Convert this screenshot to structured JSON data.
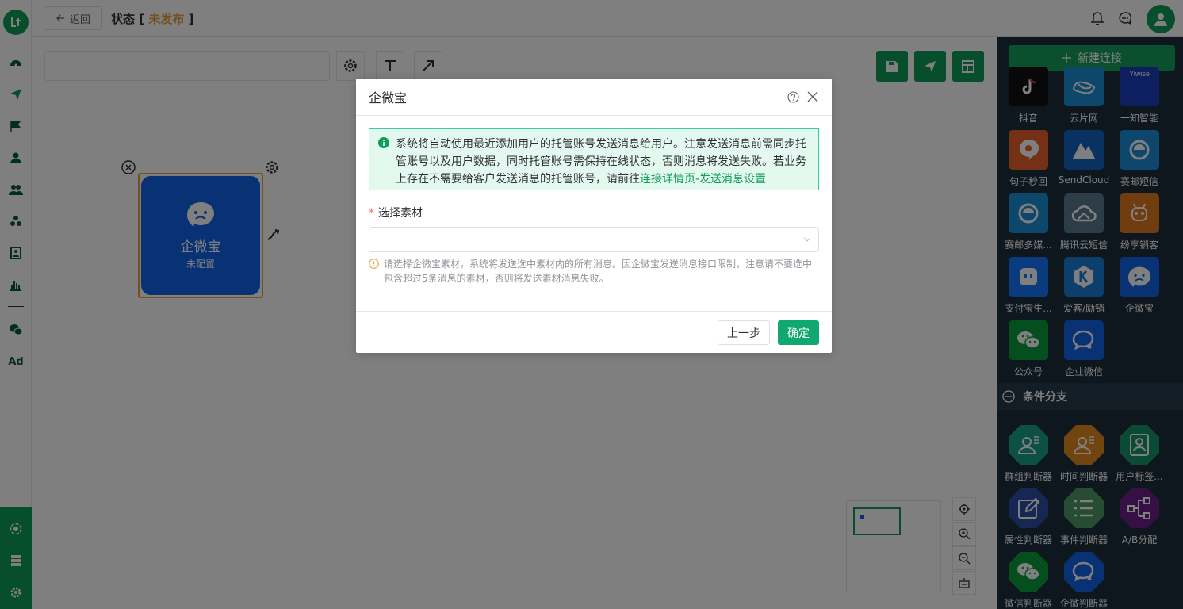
{
  "topbar": {
    "back_label": "返回",
    "status_label": "状态",
    "status_value": "未发布",
    "bracket_open": "[",
    "bracket_close": "]"
  },
  "canvas": {
    "node": {
      "name": "企微宝",
      "status": "未配置"
    }
  },
  "right_panel": {
    "new_connection_label": "新建连接",
    "connectors": [
      {
        "label": "抖音",
        "icon": "tiktok-icon",
        "color": "#111111"
      },
      {
        "label": "云片网",
        "icon": "yunpian-icon",
        "color": "#1a8fd8"
      },
      {
        "label": "一知智能",
        "icon": "yiwise-icon",
        "color": "#1a3fbf",
        "logo_text": "Yiwise"
      },
      {
        "label": "句子秒回",
        "icon": "chat-bubble-icon",
        "color": "#e8622c"
      },
      {
        "label": "SendCloud",
        "icon": "sendcloud-icon",
        "color": "#1565c0"
      },
      {
        "label": "赛邮短信",
        "icon": "submail-icon",
        "color": "#1a8fd8"
      },
      {
        "label": "赛邮多媒...",
        "icon": "submail-icon",
        "color": "#1a8fd8"
      },
      {
        "label": "腾讯云短信",
        "icon": "tencent-cloud-icon",
        "color": "#5a7a8e"
      },
      {
        "label": "纷享销客",
        "icon": "fxiaoke-icon",
        "color": "#e07a20"
      },
      {
        "label": "支付宝生...",
        "icon": "alipay-life-icon",
        "color": "#1677ff"
      },
      {
        "label": "爱客/励销",
        "icon": "aike-icon",
        "color": "#1a7fd8"
      },
      {
        "label": "企微宝",
        "icon": "qiweibao-icon",
        "color": "#1264e8"
      },
      {
        "label": "公众号",
        "icon": "wechat-icon",
        "color": "#0a9d3a"
      },
      {
        "label": "企业微信",
        "icon": "wecom-icon",
        "color": "#1264e8"
      }
    ],
    "section_title": "条件分支",
    "branches": [
      {
        "label": "群组判断器",
        "icon": "group-judge-icon",
        "color": "#1aa08a"
      },
      {
        "label": "时间判断器",
        "icon": "time-judge-icon",
        "color": "#e08a20"
      },
      {
        "label": "用户标签...",
        "icon": "user-tag-icon",
        "color": "#16946a"
      },
      {
        "label": "属性判断器",
        "icon": "edit-icon",
        "color": "#2c4fa8"
      },
      {
        "label": "事件判断器",
        "icon": "list-icon",
        "color": "#4c9a64"
      },
      {
        "label": "A/B分配",
        "icon": "ab-split-icon",
        "color": "#6c1f8a"
      },
      {
        "label": "微信判断器",
        "icon": "wechat-icon",
        "color": "#0a9d3a"
      },
      {
        "label": "企微判断器",
        "icon": "wecom-icon",
        "color": "#1264e8"
      }
    ]
  },
  "dialog": {
    "title": "企微宝",
    "alert_text": "系统将自动使用最近添加用户的托管账号发送消息给用户。注意发送消息前需同步托管账号以及用户数据，同时托管账号需保持在线状态，否则消息将发送失败。若业务上存在不需要给客户发送消息的托管账号，请前往",
    "alert_link": "连接详情页-发送消息设置",
    "field_required_mark": "*",
    "field_label": "选择素材",
    "select_value": "",
    "hint_text": "请选择企微宝素材，系统将发送选中素材内的所有消息。因企微宝发送消息接口限制，注意请不要选中包含超过5条消息的素材，否则将发送素材消息失败。",
    "prev_label": "上一步",
    "confirm_label": "确定"
  },
  "colors": {
    "brand_green": "#0f9d58",
    "status_orange": "#e6a23c",
    "panel_dark": "#1d2f3d",
    "node_blue": "#1264e8"
  }
}
